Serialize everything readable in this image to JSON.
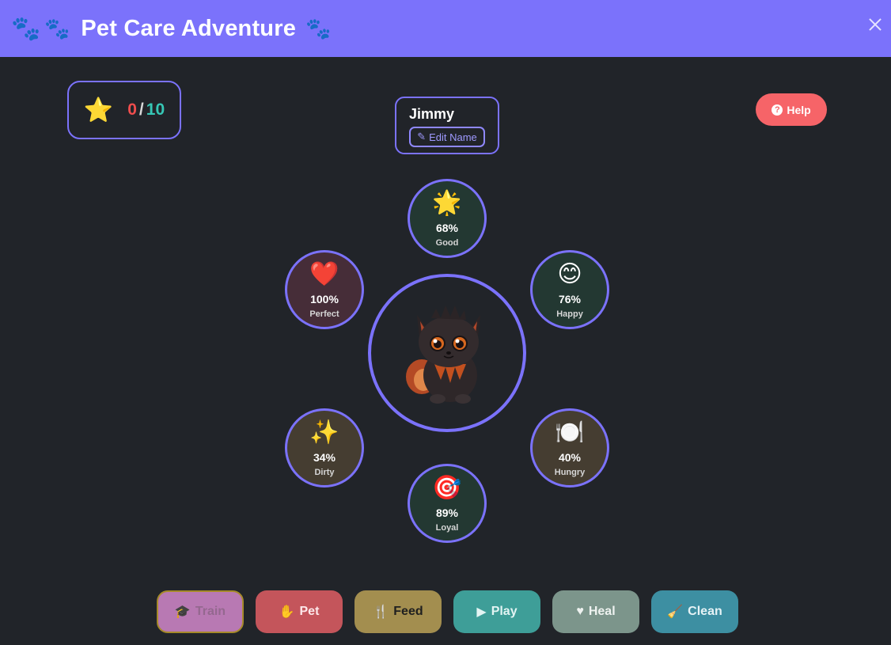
{
  "header": {
    "title": "Pet Care Adventure",
    "left_icon": "paw-icon",
    "close_icon": "close-icon"
  },
  "score": {
    "current": "0",
    "separator": "/",
    "max": "10",
    "icon": "star-icon"
  },
  "pet": {
    "name": "Jimmy",
    "edit_label": "Edit Name",
    "image": "dark fluffy creature"
  },
  "help": {
    "label": "Help"
  },
  "stats": [
    {
      "key": "mood",
      "emoji": "🌟",
      "value": "68%",
      "label": "Good"
    },
    {
      "key": "health",
      "emoji": "❤️",
      "value": "100%",
      "label": "Perfect"
    },
    {
      "key": "happy",
      "emoji": "😊",
      "value": "76%",
      "label": "Happy"
    },
    {
      "key": "clean",
      "emoji": "✨",
      "value": "34%",
      "label": "Dirty"
    },
    {
      "key": "hunger",
      "emoji": "🍽️",
      "value": "40%",
      "label": "Hungry"
    },
    {
      "key": "loyalty",
      "emoji": "🎯",
      "value": "89%",
      "label": "Loyal"
    }
  ],
  "actions": [
    {
      "label": "Train",
      "icon": "graduation-cap-icon",
      "bg": "#b879b3",
      "fg": "#94688f"
    },
    {
      "label": "Pet",
      "icon": "hand-icon",
      "bg": "#c4555b",
      "fg": "#fde8ea"
    },
    {
      "label": "Feed",
      "icon": "utensils-icon",
      "bg": "#a38e4f",
      "fg": "#1f1f1f"
    },
    {
      "label": "Play",
      "icon": "play-icon",
      "bg": "#3e9e98",
      "fg": "#e3f4f3"
    },
    {
      "label": "Heal",
      "icon": "heart-pulse-icon",
      "bg": "#7c958b",
      "fg": "#eef2f0"
    },
    {
      "label": "Clean",
      "icon": "broom-icon",
      "bg": "#3d8fa2",
      "fg": "#e6f3f6"
    }
  ],
  "colors": {
    "header_bg": "#7b72fb",
    "page_bg": "#212429",
    "accent_border": "#7b72fb",
    "help_bg": "#f66468"
  }
}
